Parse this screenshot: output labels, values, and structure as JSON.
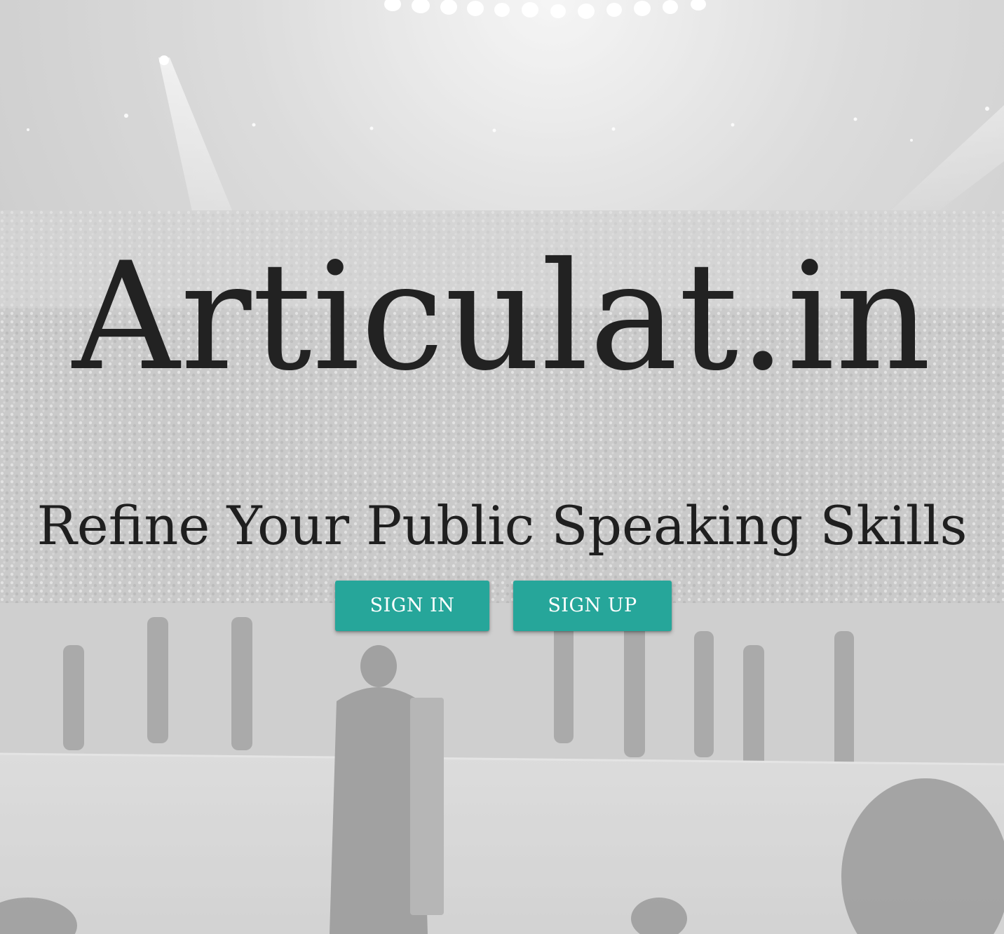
{
  "hero": {
    "background_image": "auditorium-crowd-photo",
    "overlay_color": "#ffffff"
  },
  "brand": {
    "title": "Articulat.in"
  },
  "tagline": {
    "text": "Refine Your Public Speaking Skills"
  },
  "actions": {
    "sign_in_label": "SIGN IN",
    "sign_up_label": "SIGN UP",
    "button_color": "#26a69a"
  }
}
